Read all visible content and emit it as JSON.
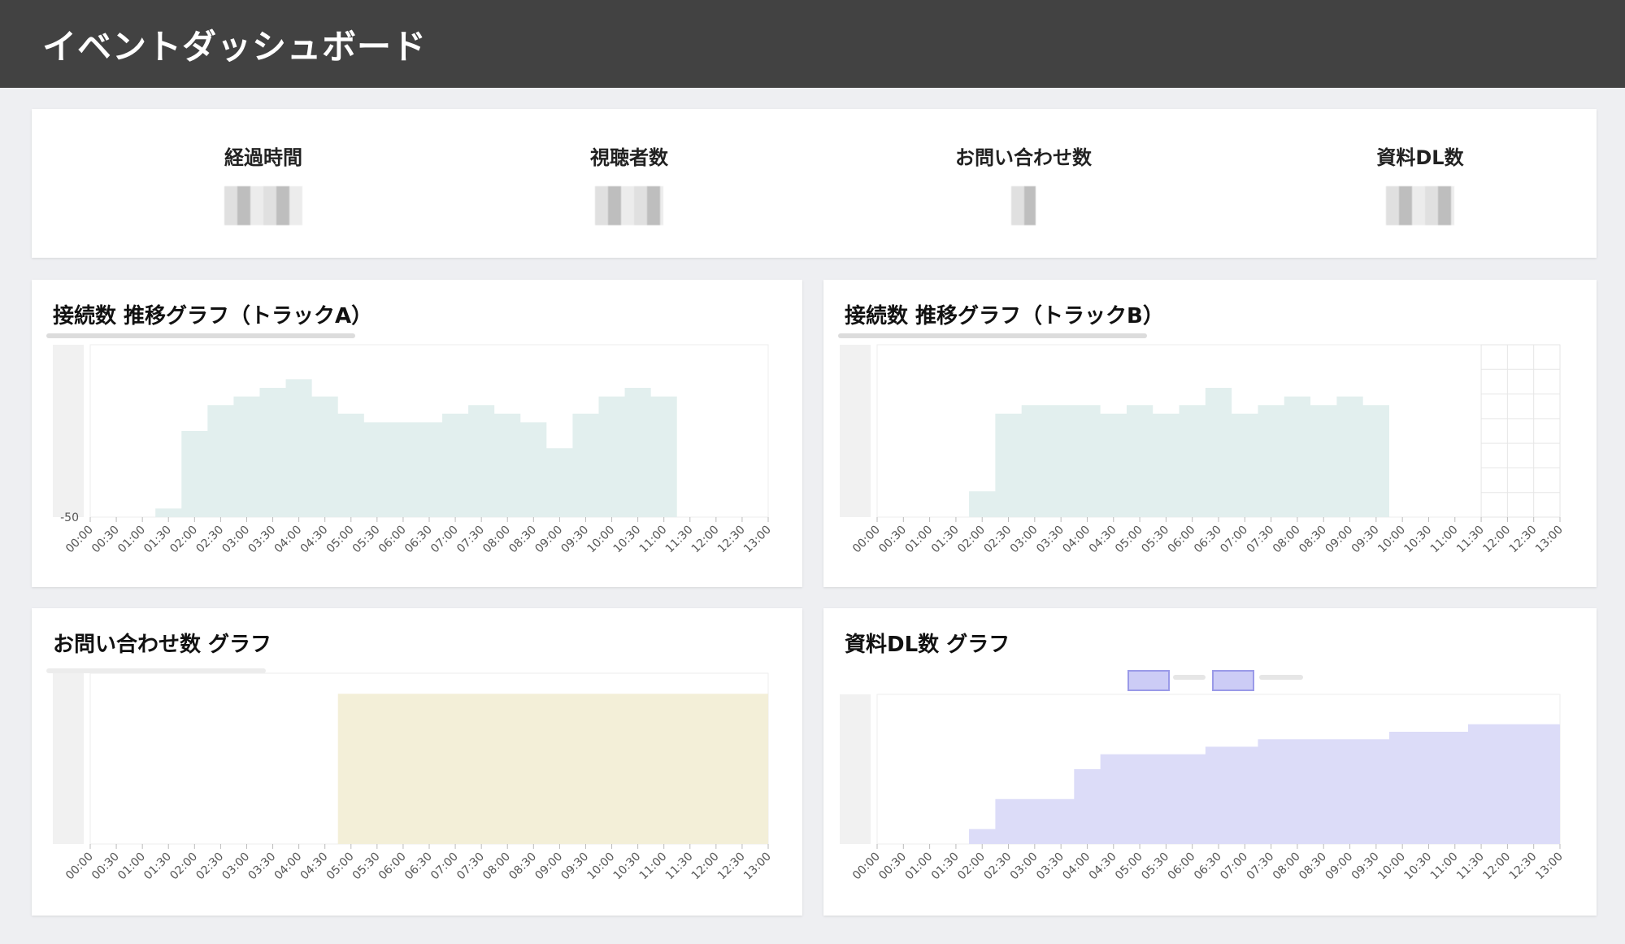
{
  "header": {
    "title": "イベントダッシュボード"
  },
  "stats": [
    {
      "label": "経過時間"
    },
    {
      "label": "視聴者数"
    },
    {
      "label": "お問い合わせ数"
    },
    {
      "label": "資料DL数"
    }
  ],
  "time_labels": [
    "00:00",
    "00:30",
    "01:00",
    "01:30",
    "02:00",
    "02:30",
    "03:00",
    "03:30",
    "04:00",
    "04:30",
    "05:00",
    "05:30",
    "06:00",
    "06:30",
    "07:00",
    "07:30",
    "08:00",
    "08:30",
    "09:00",
    "09:30",
    "10:00",
    "10:30",
    "11:00",
    "11:30",
    "12:00",
    "12:30",
    "13:00"
  ],
  "colors": {
    "header_bg": "#424242",
    "track_fill": "#e2efee",
    "inquiry_fill": "#f3efd8",
    "dl_fill": "#dcdcf8"
  },
  "panels": {
    "trackA": {
      "title": "接続数 推移グラフ（トラックA）",
      "y_min_label": "-50"
    },
    "trackB": {
      "title": "接続数 推移グラフ（トラックB）"
    },
    "inquiry": {
      "title": "お問い合わせ数 グラフ"
    },
    "dl": {
      "title": "資料DL数 グラフ"
    }
  },
  "chart_data": [
    {
      "type": "area",
      "name": "trackA",
      "x": [
        "00:00",
        "00:30",
        "01:00",
        "01:30",
        "02:00",
        "02:30",
        "03:00",
        "03:30",
        "04:00",
        "04:30",
        "05:00",
        "05:30",
        "06:00",
        "06:30",
        "07:00",
        "07:30",
        "08:00",
        "08:30",
        "09:00",
        "09:30",
        "10:00",
        "10:30",
        "11:00",
        "11:30",
        "12:00",
        "12:30",
        "13:00"
      ],
      "values": [
        0,
        0,
        0,
        5,
        50,
        65,
        70,
        75,
        80,
        70,
        60,
        55,
        55,
        55,
        60,
        65,
        60,
        55,
        40,
        60,
        70,
        75,
        70,
        0,
        0,
        0,
        0
      ]
    },
    {
      "type": "area",
      "name": "trackB",
      "x": [
        "00:00",
        "00:30",
        "01:00",
        "01:30",
        "02:00",
        "02:30",
        "03:00",
        "03:30",
        "04:00",
        "04:30",
        "05:00",
        "05:30",
        "06:00",
        "06:30",
        "07:00",
        "07:30",
        "08:00",
        "08:30",
        "09:00",
        "09:30",
        "10:00",
        "10:30",
        "11:00",
        "11:30",
        "12:00",
        "12:30",
        "13:00"
      ],
      "values": [
        0,
        0,
        0,
        0,
        15,
        60,
        65,
        65,
        65,
        60,
        65,
        60,
        65,
        75,
        60,
        65,
        70,
        65,
        70,
        65,
        0,
        0,
        0,
        0,
        0,
        0,
        0
      ]
    },
    {
      "type": "area",
      "name": "inquiry",
      "x": [
        "00:00",
        "00:30",
        "01:00",
        "01:30",
        "02:00",
        "02:30",
        "03:00",
        "03:30",
        "04:00",
        "04:30",
        "05:00",
        "05:30",
        "06:00",
        "06:30",
        "07:00",
        "07:30",
        "08:00",
        "08:30",
        "09:00",
        "09:30",
        "10:00",
        "10:30",
        "11:00",
        "11:30",
        "12:00",
        "12:30",
        "13:00"
      ],
      "values": [
        0,
        0,
        0,
        0,
        0,
        0,
        0,
        0,
        0,
        0,
        88,
        88,
        88,
        88,
        88,
        88,
        88,
        88,
        88,
        88,
        88,
        88,
        88,
        88,
        88,
        88,
        88
      ]
    },
    {
      "type": "area",
      "name": "dl",
      "x": [
        "00:00",
        "00:30",
        "01:00",
        "01:30",
        "02:00",
        "02:30",
        "03:00",
        "03:30",
        "04:00",
        "04:30",
        "05:00",
        "05:30",
        "06:00",
        "06:30",
        "07:00",
        "07:30",
        "08:00",
        "08:30",
        "09:00",
        "09:30",
        "10:00",
        "10:30",
        "11:00",
        "11:30",
        "12:00",
        "12:30",
        "13:00"
      ],
      "values": [
        0,
        0,
        0,
        0,
        10,
        30,
        30,
        30,
        50,
        60,
        60,
        60,
        60,
        65,
        65,
        70,
        70,
        70,
        70,
        70,
        75,
        75,
        75,
        80,
        80,
        80,
        80
      ]
    }
  ]
}
